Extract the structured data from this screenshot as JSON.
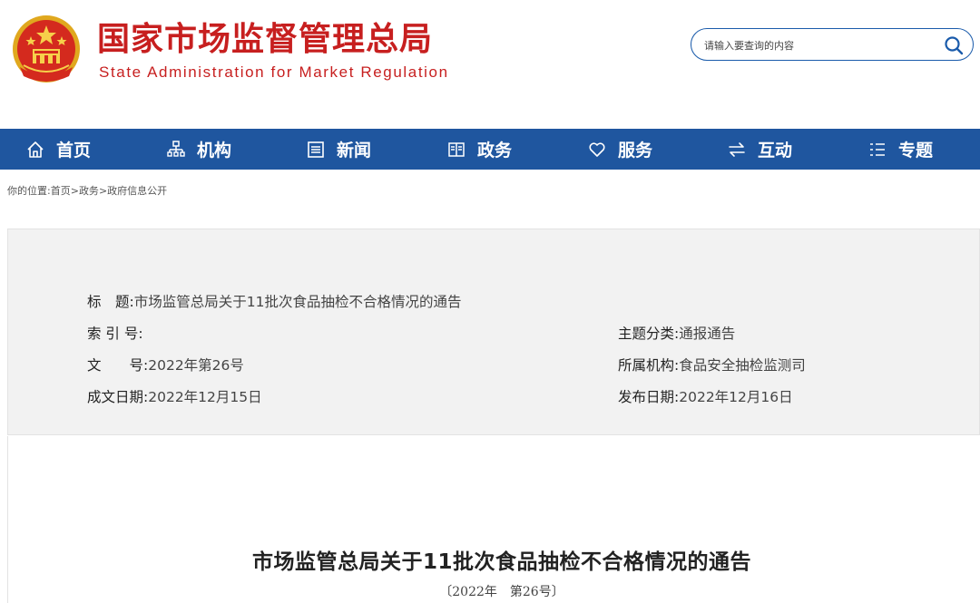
{
  "header": {
    "title": "国家市场监督管理总局",
    "subtitle": "State Administration for Market Regulation",
    "search_placeholder": "请输入要查询的内容",
    "colors": {
      "brand_red": "#c71f1f",
      "nav_blue": "#1f569f"
    }
  },
  "nav": {
    "items": [
      {
        "label": "首页",
        "icon": "home-icon"
      },
      {
        "label": "机构",
        "icon": "org-chart-icon"
      },
      {
        "label": "新闻",
        "icon": "news-icon"
      },
      {
        "label": "政务",
        "icon": "affairs-icon"
      },
      {
        "label": "服务",
        "icon": "heart-icon"
      },
      {
        "label": "互动",
        "icon": "exchange-icon"
      },
      {
        "label": "专题",
        "icon": "list-icon"
      }
    ]
  },
  "breadcrumb": {
    "prefix": "你的位置:",
    "items": [
      "首页",
      "政务",
      "政府信息公开"
    ],
    "separator": ">"
  },
  "info": {
    "title_label": "标　题:",
    "title_value": "市场监管总局关于11批次食品抽检不合格情况的通告",
    "index_label": "索 引 号:",
    "index_value": "",
    "category_label": "主题分类:",
    "category_value": "通报通告",
    "doc_no_label": "文　　号:",
    "doc_no_value": "2022年第26号",
    "agency_label": "所属机构:",
    "agency_value": "食品安全抽检监测司",
    "created_label": "成文日期:",
    "created_value": "2022年12月15日",
    "published_label": "发布日期:",
    "published_value": "2022年12月16日"
  },
  "document": {
    "title": "市场监管总局关于11批次食品抽检不合格情况的通告",
    "number": "〔2022年　第26号〕"
  }
}
